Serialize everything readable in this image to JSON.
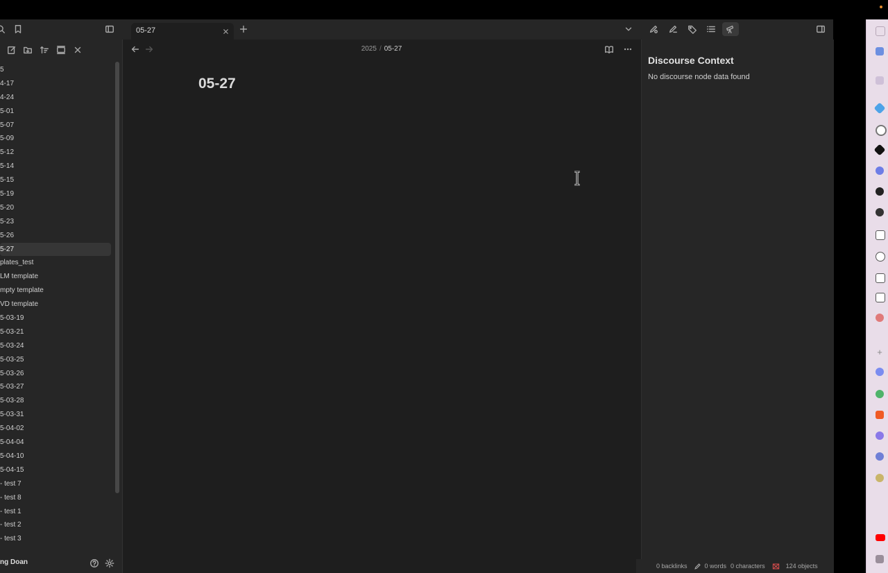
{
  "tab": {
    "title": "05-27"
  },
  "breadcrumb": {
    "parent": "2025",
    "separator": "/",
    "current": "05-27"
  },
  "page": {
    "title": "05-27"
  },
  "file_list": [
    "5",
    "4-17",
    "4-24",
    "5-01",
    "5-07",
    "5-09",
    "5-12",
    "5-14",
    "5-15",
    "5-19",
    "5-20",
    "5-23",
    "5-26",
    "5-27",
    "plates_test",
    "LM template",
    "mpty template",
    "VD template",
    "5-03-19",
    "5-03-21",
    "5-03-24",
    "5-03-25",
    "5-03-26",
    "5-03-27",
    "5-03-28",
    "5-03-31",
    "5-04-02",
    "5-04-04",
    "5-04-10",
    "5-04-15",
    "- test 7",
    "- test 8",
    "- test 1",
    "- test 2",
    "- test 3"
  ],
  "active_file_index": 13,
  "vault": {
    "name": "ng Doan"
  },
  "discourse": {
    "title": "Discourse Context",
    "message": "No discourse node data found"
  },
  "status": {
    "backlinks": "0 backlinks",
    "words": "0 words",
    "characters": "0 characters",
    "objects": "124 objects"
  },
  "colors": {
    "accent_orange": "#e38a2c",
    "status_warning": "#d04b4b",
    "browser_sidebar": "#e9dde9"
  },
  "icons": {
    "top_left": [
      "search-icon",
      "bookmark-icon",
      "sidebar-toggle-icon"
    ],
    "side_toolbar": [
      "new-note-icon",
      "new-folder-icon",
      "sort-icon",
      "collapse-all-icon",
      "close-icon"
    ],
    "ribbon_right": [
      "chevron-down-icon",
      "pencil-link-icon",
      "pencil-icon",
      "tag-icon",
      "list-icon",
      "telescope-icon",
      "right-sidebar-icon"
    ],
    "main_header": [
      "back-arrow-icon",
      "forward-arrow-icon",
      "reading-view-icon",
      "more-options-icon"
    ]
  }
}
